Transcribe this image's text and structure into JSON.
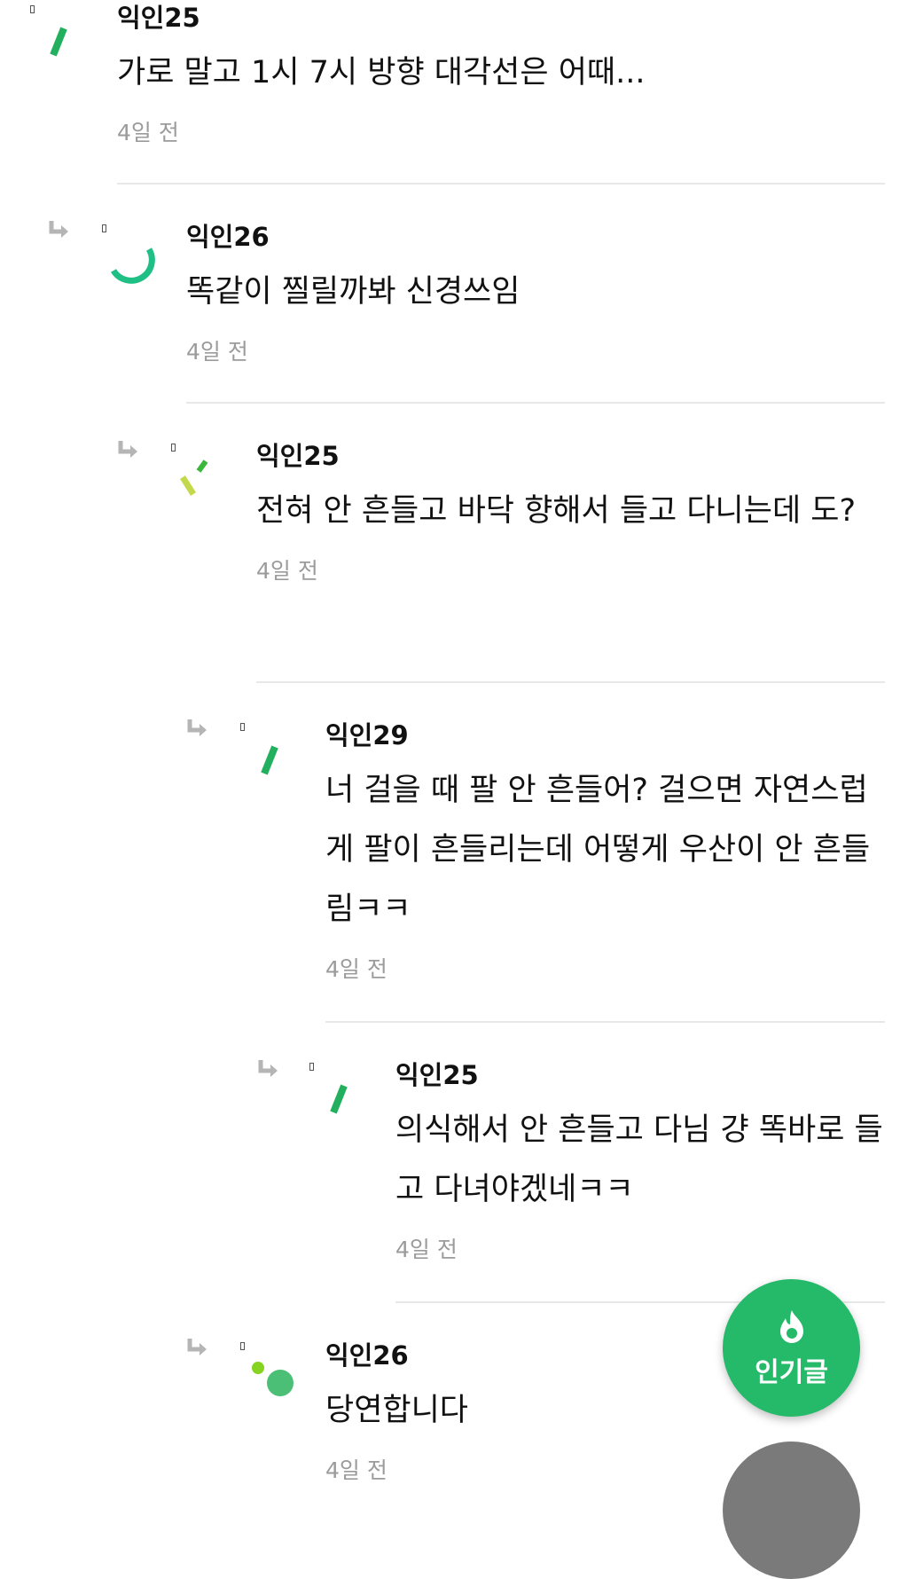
{
  "comments": [
    {
      "author": "익인25",
      "text": "가로 말고 1시 7시 방향 대각선은 어때...",
      "time": "4일 전"
    },
    {
      "author": "익인26",
      "text": "똑같이 찔릴까봐 신경쓰임",
      "time": "4일 전"
    },
    {
      "author": "익인25",
      "text": "전혀 안 흔들고 바닥 향해서 들고 다니는데 도?",
      "time": "4일 전"
    },
    {
      "author": "익인29",
      "text": "너 걸을 때 팔 안 흔들어? 걸으면 자연스럽게 팔이 흔들리는데 어떻게 우산이 안 흔들림ㅋㅋ",
      "time": "4일 전"
    },
    {
      "author": "익인25",
      "text": "의식해서 안 흔들고 다님 걍 똑바로 들고 다녀야겠네ㅋㅋ",
      "time": "4일 전"
    },
    {
      "author": "익인26",
      "text": "당연합니다",
      "time": "4일 전"
    }
  ],
  "fab": {
    "label": "인기글",
    "icon": "flame-icon"
  },
  "colors": {
    "accent": "#25b96a",
    "time": "#9b9b9b",
    "divider": "#e8e8e8"
  }
}
